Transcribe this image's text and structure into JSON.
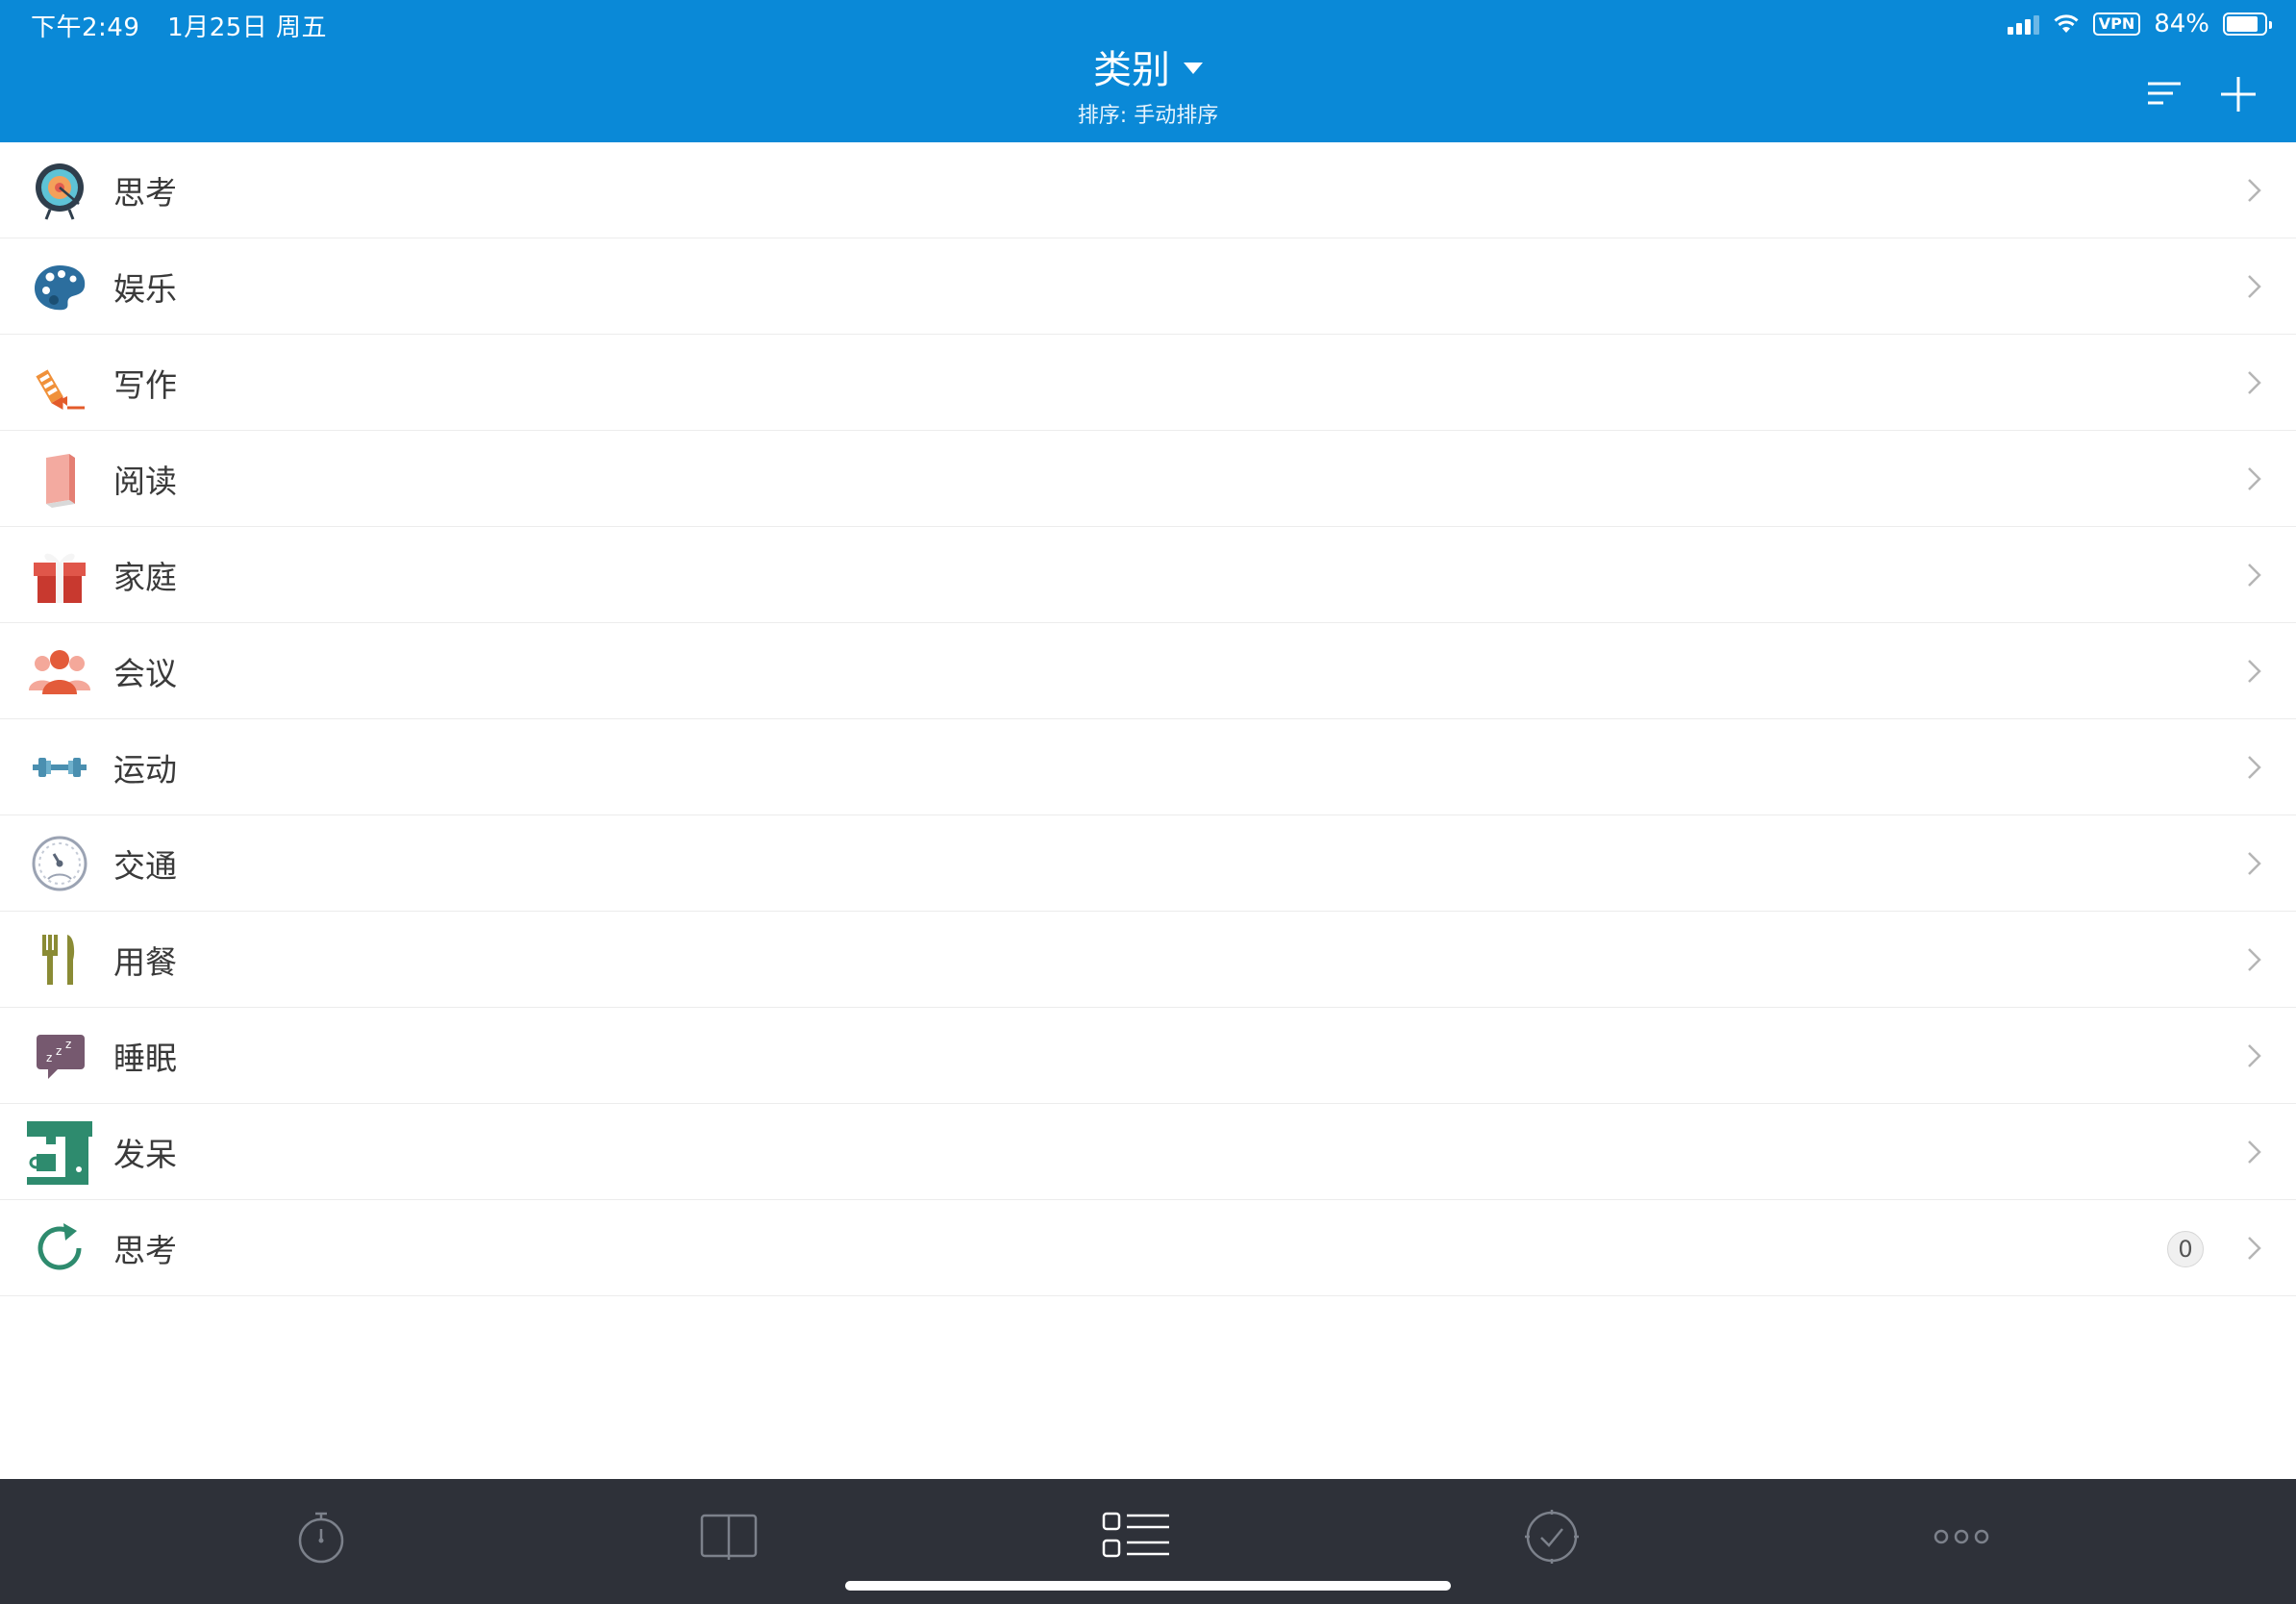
{
  "status_bar": {
    "time": "下午2:49",
    "date": "1月25日 周五",
    "vpn": "VPN",
    "battery": "84%",
    "battery_level": 0.84
  },
  "header": {
    "title": "类别",
    "subtitle": "排序: 手动排序"
  },
  "categories": [
    {
      "label": "思考",
      "icon": "target-icon"
    },
    {
      "label": "娱乐",
      "icon": "palette-icon"
    },
    {
      "label": "写作",
      "icon": "pencil-icon"
    },
    {
      "label": "阅读",
      "icon": "book-icon"
    },
    {
      "label": "家庭",
      "icon": "gift-icon"
    },
    {
      "label": "会议",
      "icon": "people-icon"
    },
    {
      "label": "运动",
      "icon": "dumbbell-icon"
    },
    {
      "label": "交通",
      "icon": "speedometer-icon"
    },
    {
      "label": "用餐",
      "icon": "fork-knife-icon"
    },
    {
      "label": "睡眠",
      "icon": "sleep-bubble-icon"
    },
    {
      "label": "发呆",
      "icon": "coffee-machine-icon"
    },
    {
      "label": "思考",
      "icon": "refresh-icon",
      "count": "0"
    }
  ],
  "tabbar": {
    "tabs": [
      "stopwatch-icon",
      "book-open-icon",
      "list-icon",
      "check-circle-icon",
      "more-icon"
    ],
    "active": 2,
    "colors": {
      "active": "#ffffff",
      "inactive": "#7c818b"
    }
  },
  "colors": {
    "header": "#0a89d7",
    "tabbar": "#2e3139"
  }
}
